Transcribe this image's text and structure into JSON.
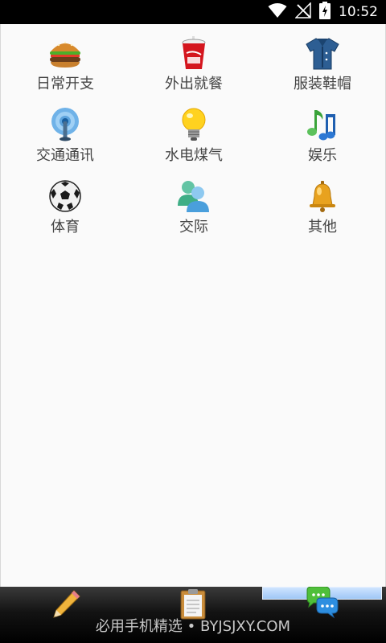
{
  "status_bar": {
    "time": "10:52",
    "icons": [
      "wifi-icon",
      "no-signal-icon",
      "battery-charging-icon"
    ]
  },
  "categories": [
    {
      "label": "日常开支",
      "icon": "hamburger-icon"
    },
    {
      "label": "外出就餐",
      "icon": "soda-cup-icon"
    },
    {
      "label": "服装鞋帽",
      "icon": "shirt-icon"
    },
    {
      "label": "交通通讯",
      "icon": "antenna-icon"
    },
    {
      "label": "水电煤气",
      "icon": "lightbulb-icon"
    },
    {
      "label": "娱乐",
      "icon": "music-note-icon"
    },
    {
      "label": "体育",
      "icon": "soccer-ball-icon"
    },
    {
      "label": "交际",
      "icon": "people-icon"
    },
    {
      "label": "其他",
      "icon": "bell-icon"
    }
  ],
  "bottom_bar": {
    "tabs": [
      {
        "icon": "pencil-icon"
      },
      {
        "icon": "clipboard-icon"
      },
      {
        "icon": "chat-bubbles-icon",
        "selected": true
      }
    ],
    "watermark": "必用手机精选 • BYJSJXY.COM"
  }
}
